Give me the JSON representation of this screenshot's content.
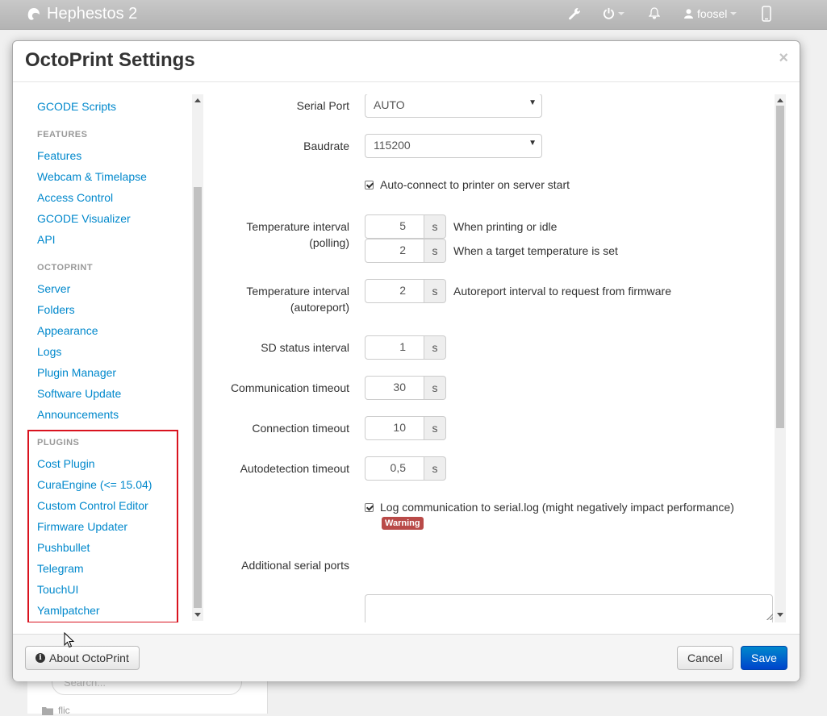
{
  "navbar": {
    "brand": "Hephestos 2",
    "user": "foosel",
    "icons": [
      "wrench-icon",
      "power-icon",
      "bell-icon",
      "user-icon",
      "mobile-icon"
    ]
  },
  "modal": {
    "title": "OctoPrint Settings",
    "close": "×"
  },
  "sidebar": {
    "top_item": "GCODE Scripts",
    "features_header": "FEATURES",
    "features": [
      "Features",
      "Webcam & Timelapse",
      "Access Control",
      "GCODE Visualizer",
      "API"
    ],
    "octoprint_header": "OCTOPRINT",
    "octoprint": [
      "Server",
      "Folders",
      "Appearance",
      "Logs",
      "Plugin Manager",
      "Software Update",
      "Announcements"
    ],
    "plugins_header": "PLUGINS",
    "plugins": [
      "Cost Plugin",
      "CuraEngine (<= 15.04)",
      "Custom Control Editor",
      "Firmware Updater",
      "Pushbullet",
      "Telegram",
      "TouchUI",
      "Yamlpatcher"
    ]
  },
  "form": {
    "serial_port": {
      "label": "Serial Port",
      "value": "AUTO"
    },
    "baudrate": {
      "label": "Baudrate",
      "value": "115200"
    },
    "autoconnect": {
      "label": "Auto-connect to printer on server start",
      "checked": true
    },
    "temp_polling": {
      "label_line1": "Temperature interval",
      "label_line2": "(polling)",
      "value1": "5",
      "unit1": "s",
      "hint1": "When printing or idle",
      "value2": "2",
      "unit2": "s",
      "hint2": "When a target temperature is set"
    },
    "temp_autoreport": {
      "label_line1": "Temperature interval",
      "label_line2": "(autoreport)",
      "value": "2",
      "unit": "s",
      "hint": "Autoreport interval to request from firmware"
    },
    "sd_status": {
      "label": "SD status interval",
      "value": "1",
      "unit": "s"
    },
    "comm_timeout": {
      "label": "Communication timeout",
      "value": "30",
      "unit": "s"
    },
    "conn_timeout": {
      "label": "Connection timeout",
      "value": "10",
      "unit": "s"
    },
    "autodetect_timeout": {
      "label": "Autodetection timeout",
      "value": "0,5",
      "unit": "s"
    },
    "log_comm": {
      "label": "Log communication to serial.log (might negatively impact performance)",
      "checked": true,
      "badge": "Warning"
    },
    "additional_ports": {
      "label": "Additional serial ports",
      "value": ""
    }
  },
  "footer": {
    "about": "About OctoPrint",
    "cancel": "Cancel",
    "save": "Save"
  },
  "background": {
    "search_placeholder": "Search...",
    "folder": "flic"
  },
  "colors": {
    "link": "#0088cc",
    "primary": "#0044cc",
    "warning": "#b94a48",
    "highlight": "#d9131f"
  }
}
